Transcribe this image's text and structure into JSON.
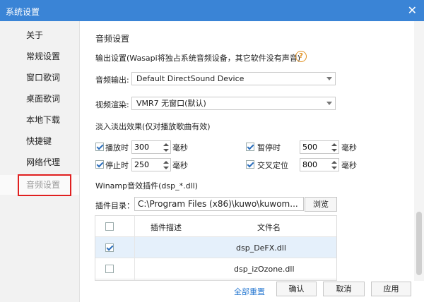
{
  "window": {
    "title": "系统设置",
    "close_glyph": "✕"
  },
  "sidebar": {
    "items": [
      {
        "label": "关于"
      },
      {
        "label": "常规设置"
      },
      {
        "label": "窗口歌词"
      },
      {
        "label": "桌面歌词"
      },
      {
        "label": "本地下载"
      },
      {
        "label": "快捷键"
      },
      {
        "label": "网络代理"
      },
      {
        "label": "音频设置",
        "active": true
      }
    ]
  },
  "audio": {
    "section_title": "音频设置",
    "output_note": "输出设置(Wasapi将独占系统音频设备，其它软件没有声音)",
    "help_glyph": "?",
    "audio_output_label": "音频输出:",
    "audio_output_value": "Default DirectSound Device",
    "video_render_label": "视频渲染:",
    "video_render_value": "VMR7 无窗口(默认)",
    "fade_title": "淡入淡出效果(仅对播放歌曲有效)",
    "fade": {
      "play": {
        "label": "播放时",
        "value": "300",
        "unit": "毫秒",
        "checked": true
      },
      "pause": {
        "label": "暂停时",
        "value": "500",
        "unit": "毫秒",
        "checked": true
      },
      "stop": {
        "label": "停止时",
        "value": "250",
        "unit": "毫秒",
        "checked": true
      },
      "crossfade": {
        "label": "交叉定位",
        "value": "800",
        "unit": "毫秒",
        "checked": true
      }
    },
    "winamp_title": "Winamp音效插件(dsp_*.dll)",
    "plugin_dir_label": "插件目录：",
    "plugin_dir_value": "C:\\Program Files (x86)\\kuwo\\kuwom...",
    "browse_label": "浏览",
    "table": {
      "headers": {
        "desc": "插件描述",
        "file": "文件名"
      },
      "rows": [
        {
          "file": "dsp_DeFX.dll",
          "checked": true,
          "selected": true
        },
        {
          "file": "dsp_izOzone.dll",
          "checked": false,
          "selected": false
        }
      ]
    }
  },
  "footer": {
    "reset_all": "全部重置",
    "ok": "确认",
    "cancel": "取消",
    "apply": "应用"
  }
}
